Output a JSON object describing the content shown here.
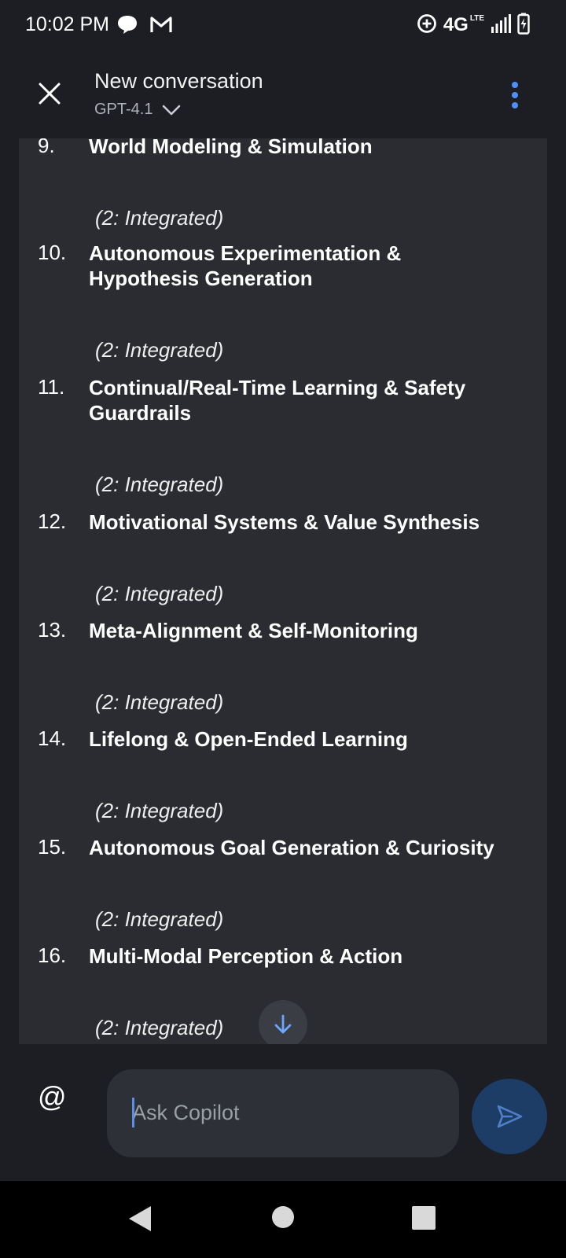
{
  "status_bar": {
    "time": "10:02 PM",
    "notifications": [
      "chat-bubble-icon",
      "gmail-icon"
    ],
    "network_label": "4G",
    "network_sub": "LTE",
    "icons": [
      "data-saver-icon",
      "signal-icon",
      "battery-charging-icon"
    ]
  },
  "header": {
    "title": "New conversation",
    "model": "GPT-4.1",
    "close_icon": "close-icon",
    "model_icon": "chevron-down-icon",
    "menu_icon": "more-vert-icon",
    "accent": "#4f8ff7"
  },
  "chat": {
    "items": [
      {
        "number": "9.",
        "lines": [
          "World Modeling & Simulation"
        ],
        "status": "(2: Integrated)"
      },
      {
        "number": "10.",
        "lines": [
          "Autonomous Experimentation &",
          "Hypothesis Generation"
        ],
        "status": "(2: Integrated)"
      },
      {
        "number": "11.",
        "lines": [
          "Continual/Real-Time Learning & Safety",
          "Guardrails"
        ],
        "status": "(2: Integrated)"
      },
      {
        "number": "12.",
        "lines": [
          "Motivational Systems & Value Synthesis"
        ],
        "status": "(2: Integrated)"
      },
      {
        "number": "13.",
        "lines": [
          "Meta-Alignment & Self-Monitoring"
        ],
        "status": "(2: Integrated)"
      },
      {
        "number": "14.",
        "lines": [
          "Lifelong & Open-Ended Learning"
        ],
        "status": "(2: Integrated)"
      },
      {
        "number": "15.",
        "lines": [
          "Autonomous Goal Generation & Curiosity"
        ],
        "status": "(2: Integrated)"
      },
      {
        "number": "16.",
        "lines": [
          "Multi-Modal Perception & Action"
        ],
        "status": "(2: Integrated)"
      }
    ]
  },
  "composer": {
    "mention": "@",
    "placeholder": "Ask Copilot",
    "send_icon": "send-icon",
    "scroll_icon": "arrow-down-icon"
  },
  "nav": {
    "icons": [
      "back-icon",
      "home-icon",
      "recents-icon"
    ]
  }
}
